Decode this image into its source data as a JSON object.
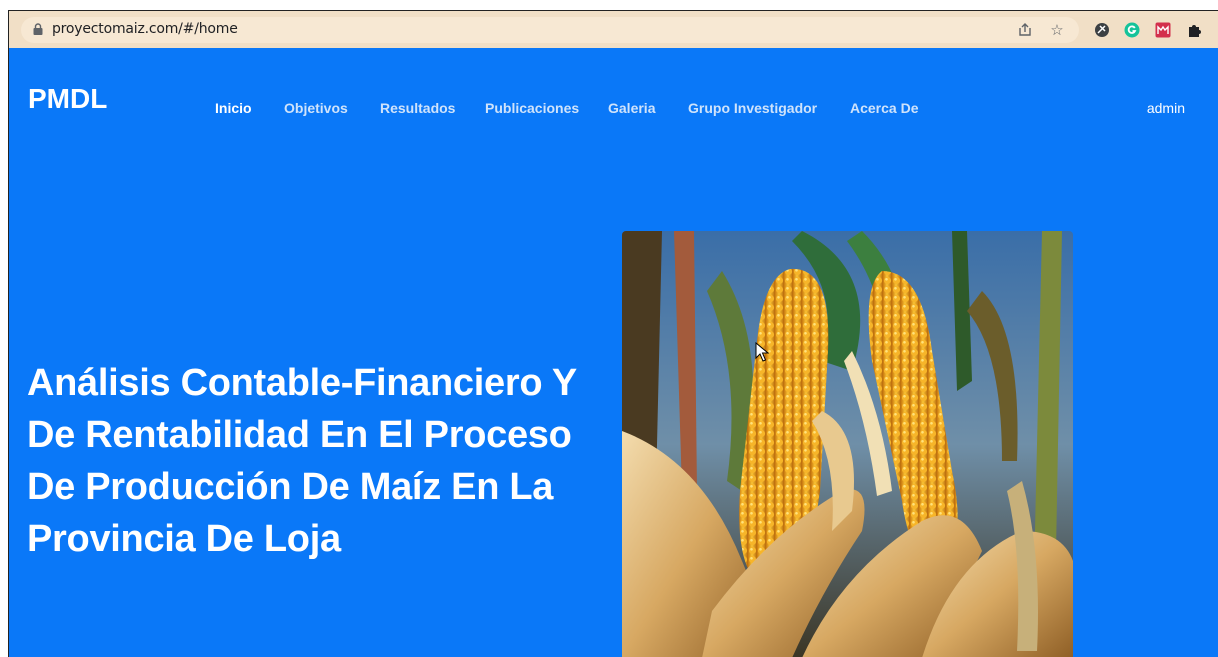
{
  "browser": {
    "url": "proyectomaiz.com/#/home",
    "icons": [
      "share-icon",
      "star-icon",
      "extension-icon",
      "grammarly-icon",
      "extension-red-icon",
      "puzzle-icon"
    ]
  },
  "nav": {
    "brand": "PMDL",
    "links": [
      "Inicio",
      "Objetivos",
      "Resultados",
      "Publicaciones",
      "Galeria",
      "Grupo Investigador",
      "Acerca De"
    ],
    "active": "Inicio",
    "user": "admin"
  },
  "hero": {
    "title": "Análisis Contable-Financiero Y De Rentabilidad En El Proceso De Producción De Maíz En La Provincia De Loja",
    "image": "corn-cobs-photo"
  },
  "colors": {
    "page_background": "#0a78f8",
    "address_bar": "#f1dfc6"
  }
}
